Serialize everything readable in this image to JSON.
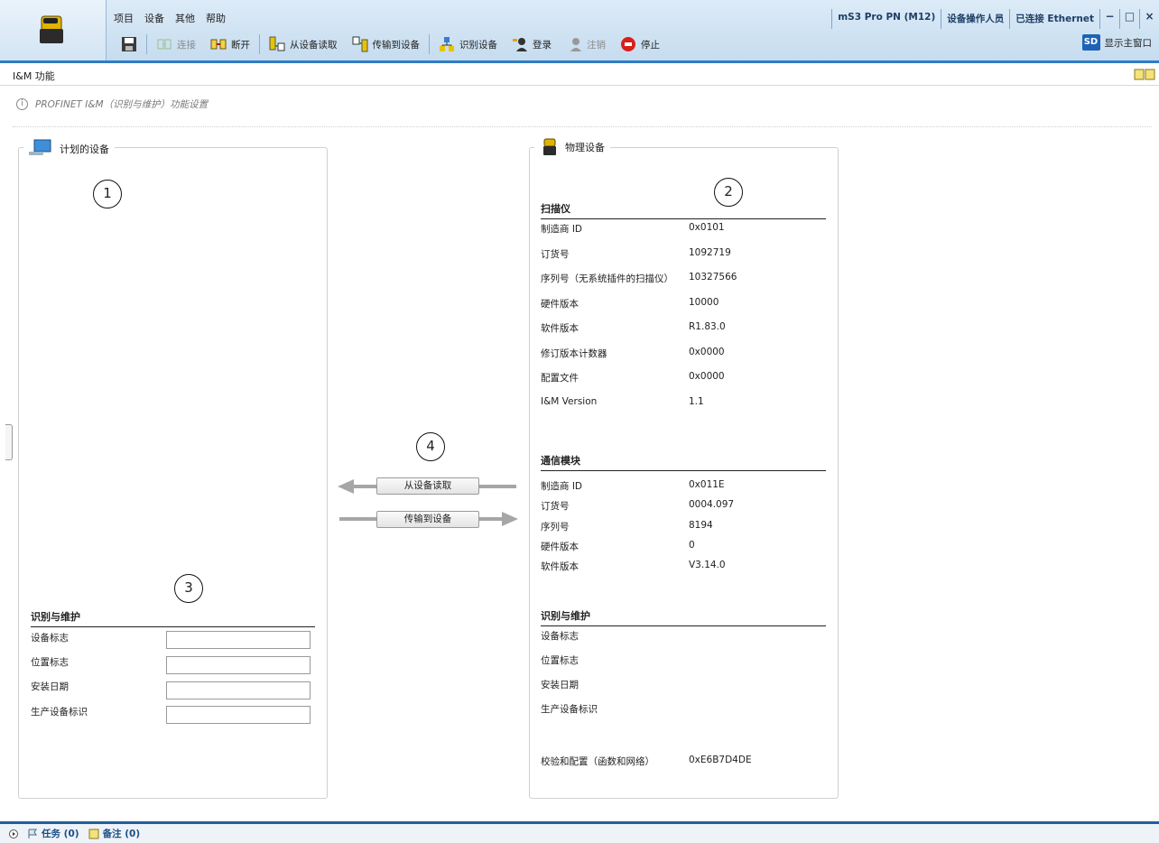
{
  "menu": [
    "项目",
    "设备",
    "其他",
    "帮助"
  ],
  "status": {
    "device": "mS3 Pro PN (M12)",
    "user": "设备操作人员",
    "connection": "已连接 Ethernet"
  },
  "window_controls": {
    "minimize": "−",
    "maximize": "□",
    "close": "×"
  },
  "toolbar": {
    "connect": "连接",
    "disconnect": "断开",
    "read_from_device": "从设备读取",
    "transfer_to_device": "传输到设备",
    "identify_device": "识别设备",
    "login": "登录",
    "logout": "注销",
    "stop": "停止",
    "show_main_window": "显示主窗口",
    "sd_label": "SD"
  },
  "page": {
    "title": "I&M 功能",
    "info": "PROFINET I&M（识别与维护）功能设置"
  },
  "planned": {
    "title": "计划的设备",
    "marker": "1",
    "marker3": "3",
    "section": "识别与维护",
    "fields": [
      {
        "label": "设备标志",
        "value": ""
      },
      {
        "label": "位置标志",
        "value": ""
      },
      {
        "label": "安装日期",
        "value": ""
      },
      {
        "label": "生产设备标识",
        "value": ""
      }
    ]
  },
  "transfer": {
    "marker": "4",
    "read_button": "从设备读取",
    "write_button": "传输到设备"
  },
  "physical": {
    "title": "物理设备",
    "marker": "2",
    "scanner": {
      "heading": "扫描仪",
      "rows": [
        {
          "label": "制造商 ID",
          "value": "0x0101"
        },
        {
          "label": "订货号",
          "value": "1092719"
        },
        {
          "label": "序列号（无系统插件的扫描仪）",
          "value": "10327566"
        },
        {
          "label": "硬件版本",
          "value": "10000"
        },
        {
          "label": "软件版本",
          "value": "R1.83.0"
        },
        {
          "label": "修订版本计数器",
          "value": "0x0000"
        },
        {
          "label": "配置文件",
          "value": "0x0000"
        },
        {
          "label": "I&M Version",
          "value": "1.1"
        }
      ]
    },
    "comm": {
      "heading": "通信模块",
      "rows": [
        {
          "label": "制造商 ID",
          "value": "0x011E"
        },
        {
          "label": "订货号",
          "value": "0004.097"
        },
        {
          "label": "序列号",
          "value": "8194"
        },
        {
          "label": "硬件版本",
          "value": "0"
        },
        {
          "label": "软件版本",
          "value": "V3.14.0"
        }
      ]
    },
    "im": {
      "heading": "识别与维护",
      "rows": [
        {
          "label": "设备标志",
          "value": ""
        },
        {
          "label": "位置标志",
          "value": ""
        },
        {
          "label": "安装日期",
          "value": ""
        },
        {
          "label": "生产设备标识",
          "value": ""
        }
      ]
    },
    "checksum": {
      "label": "校验和配置（函数和网络）",
      "value": "0xE6B7D4DE"
    }
  },
  "bottom": {
    "tasks": "任务 (0)",
    "notes": "备注 (0)"
  }
}
